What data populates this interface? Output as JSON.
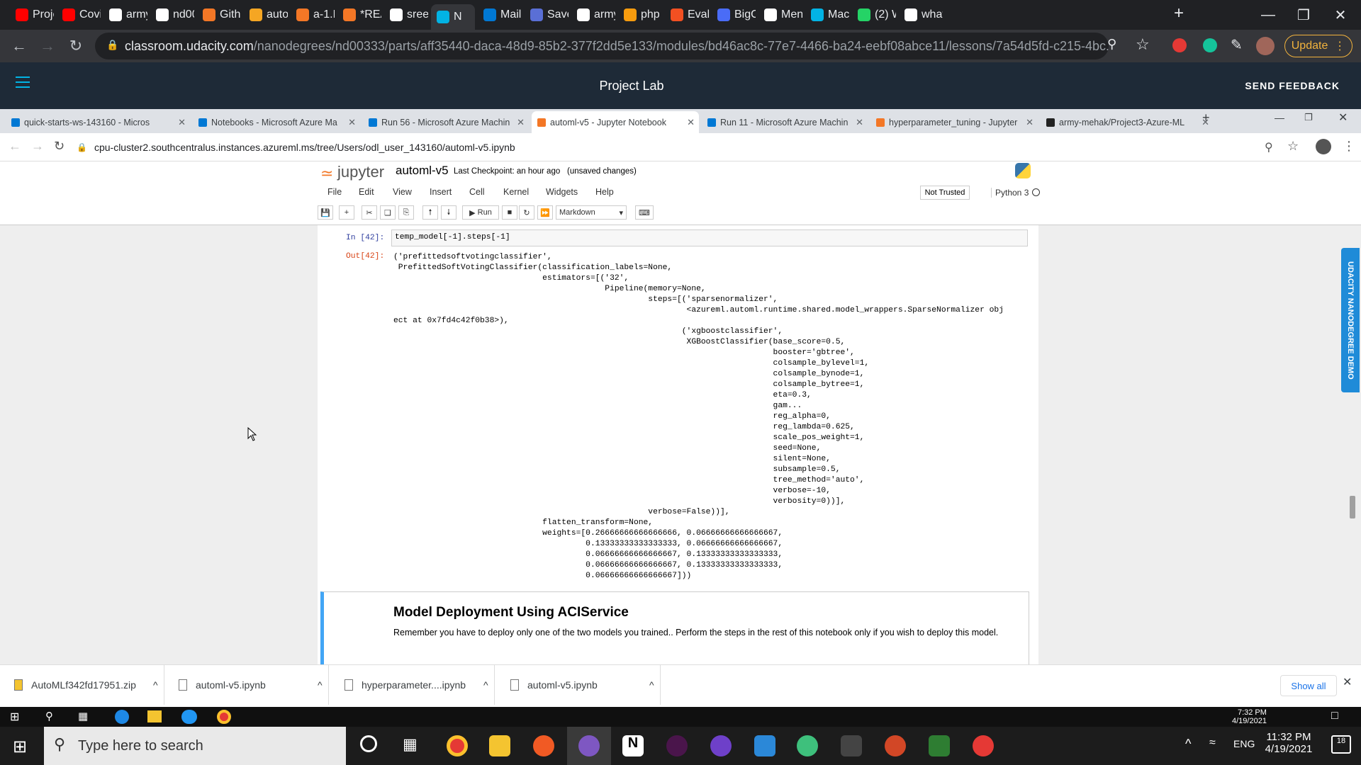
{
  "outer_tabs": [
    {
      "label": "Proje",
      "icon": "youtube-icon",
      "color": "#ff0000"
    },
    {
      "label": "Covi",
      "icon": "youtube-icon",
      "color": "#ff0000"
    },
    {
      "label": "army",
      "icon": "github-icon",
      "color": "#ffffff"
    },
    {
      "label": "nd00",
      "icon": "github-icon",
      "color": "#ffffff"
    },
    {
      "label": "Githu",
      "icon": "jupyter-icon",
      "color": "#f37726"
    },
    {
      "label": "auto",
      "icon": "azure-notebook-icon",
      "color": "#f5a623"
    },
    {
      "label": "a-1.F",
      "icon": "jupyter-icon",
      "color": "#f37726"
    },
    {
      "label": "*REA",
      "icon": "file-icon",
      "color": "#f37726"
    },
    {
      "label": "sree",
      "icon": "github-icon",
      "color": "#ffffff"
    },
    {
      "label": "N",
      "icon": "udacity-icon",
      "color": "#02b3e4"
    },
    {
      "label": "Mail",
      "icon": "outlook-icon",
      "color": "#0078d4"
    },
    {
      "label": "Save",
      "icon": "sheet-icon",
      "color": "#5a6fd6"
    },
    {
      "label": "army",
      "icon": "github-icon",
      "color": "#ffffff"
    },
    {
      "label": "php",
      "icon": "phpmyadmin-icon",
      "color": "#f89c0e"
    },
    {
      "label": "Evalu",
      "icon": "microsoft-icon",
      "color": "#f25022"
    },
    {
      "label": "BigO",
      "icon": "search-icon",
      "color": "#4a6cf7"
    },
    {
      "label": "Men",
      "icon": "notion-icon",
      "color": "#ffffff"
    },
    {
      "label": "Macl",
      "icon": "udacity-icon",
      "color": "#02b3e4"
    },
    {
      "label": "(2) W",
      "icon": "whatsapp-icon",
      "color": "#25d366"
    },
    {
      "label": "what",
      "icon": "google-icon",
      "color": "#ffffff"
    }
  ],
  "outer_url": {
    "host": "classroom.udacity.com",
    "path": "/nanodegrees/nd00333/parts/aff35440-daca-48d9-85b2-377f2dd5e133/modules/bd46ac8c-77e7-4466-ba24-eebf08abce11/lessons/7a54d5fd-c215-4bc..."
  },
  "update_label": "Update",
  "udacity_header": {
    "title": "Project Lab",
    "feedback": "SEND FEEDBACK"
  },
  "inner_tabs": [
    {
      "label": "quick-starts-ws-143160 - Micros"
    },
    {
      "label": "Notebooks - Microsoft Azure Ma"
    },
    {
      "label": "Run 56 - Microsoft Azure Machin"
    },
    {
      "label": "automl-v5 - Jupyter Notebook"
    },
    {
      "label": "Run 11 - Microsoft Azure Machin"
    },
    {
      "label": "hyperparameter_tuning - Jupyter"
    },
    {
      "label": "army-mehak/Project3-Azure-ML"
    }
  ],
  "inner_url": "cpu-cluster2.southcentralus.instances.azureml.ms/tree/Users/odl_user_143160/automl-v5.ipynb",
  "jupyter": {
    "logo": "jupyter",
    "notebook": "automl-v5",
    "checkpoint": "Last Checkpoint: an hour ago",
    "unsaved": "(unsaved changes)",
    "menus": [
      "File",
      "Edit",
      "View",
      "Insert",
      "Cell",
      "Kernel",
      "Widgets",
      "Help"
    ],
    "trust": "Not Trusted",
    "kernel": "Python 3",
    "run_label": "Run",
    "cell_type": "Markdown"
  },
  "cell": {
    "in_prompt": "In [42]:",
    "in_code": "temp_model[-1].steps[-1]",
    "out_prompt": "Out[42]:",
    "output": [
      "('prefittedsoftvotingclassifier',",
      " PrefittedSoftVotingClassifier(classification_labels=None,",
      "                               estimators=[('32',",
      "                                            Pipeline(memory=None,",
      "                                                     steps=[('sparsenormalizer',",
      "                                                             <azureml.automl.runtime.shared.model_wrappers.SparseNormalizer obj",
      "ect at 0x7fd4c42f0b38>),",
      "                                                            ('xgboostclassifier',",
      "                                                             XGBoostClassifier(base_score=0.5,",
      "                                                                               booster='gbtree',",
      "                                                                               colsample_bylevel=1,",
      "                                                                               colsample_bynode=1,",
      "                                                                               colsample_bytree=1,",
      "                                                                               eta=0.3,",
      "                                                                               gam...",
      "                                                                               reg_alpha=0,",
      "                                                                               reg_lambda=0.625,",
      "                                                                               scale_pos_weight=1,",
      "                                                                               seed=None,",
      "                                                                               silent=None,",
      "                                                                               subsample=0.5,",
      "                                                                               tree_method='auto',",
      "                                                                               verbose=-10,",
      "                                                                               verbosity=0))],",
      "                                                     verbose=False))],",
      "                               flatten_transform=None,",
      "                               weights=[0.26666666666666666, 0.06666666666666667,",
      "                                        0.13333333333333333, 0.06666666666666667,",
      "                                        0.06666666666666667, 0.13333333333333333,",
      "                                        0.06666666666666667, 0.13333333333333333,",
      "                                        0.06666666666666667]))"
    ]
  },
  "markdown": {
    "heading": "Model Deployment Using ACIService",
    "text": "Remember you have to deploy only one of the two models you trained.. Perform the steps in the rest of this notebook only if you wish to deploy this model."
  },
  "side_tab": "UDACITY NANODEGREE DEMO",
  "downloads": [
    {
      "name": "AutoMLf342fd17951.zip"
    },
    {
      "name": "automl-v5.ipynb"
    },
    {
      "name": "hyperparameter....ipynb"
    },
    {
      "name": "automl-v5.ipynb"
    }
  ],
  "show_all": "Show all",
  "tray1": {
    "time": "7:32 PM",
    "date": "4/19/2021"
  },
  "taskbar": {
    "search_placeholder": "Type here to search",
    "lang": "ENG",
    "time": "11:32 PM",
    "date": "4/19/2021",
    "notif": "18"
  }
}
